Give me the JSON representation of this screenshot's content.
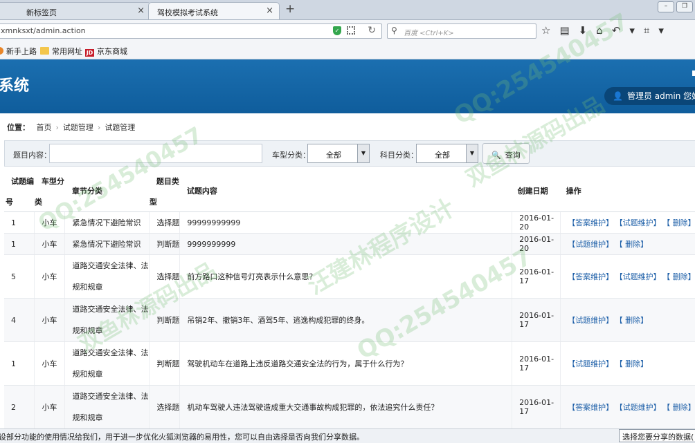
{
  "browser": {
    "tabs": [
      {
        "label": "新标签页",
        "active": false
      },
      {
        "label": "驾校模拟考试系统",
        "active": true
      }
    ],
    "new_tab": "+",
    "url": "xmnksxt/admin.action",
    "search_placeholder": "百度 <Ctrl+K>",
    "bookmarks": [
      {
        "label": "新手上路",
        "icon": "firefox-icon"
      },
      {
        "label": "常用网址",
        "icon": "folder-icon"
      },
      {
        "label": "京东商城",
        "icon": "jd-icon"
      }
    ]
  },
  "header": {
    "title": "系统",
    "user": "管理员 admin 您好"
  },
  "breadcrumb": {
    "label": "位置：",
    "items": [
      "首页",
      "试题管理",
      "试题管理"
    ]
  },
  "filters": {
    "content_label": "题目内容：",
    "car_label": "车型分类：",
    "car_value": "全部",
    "subject_label": "科目分类：",
    "subject_value": "全部",
    "query_button": "查询"
  },
  "table": {
    "headers": {
      "id_top": "试题编",
      "id_bottom": "号",
      "car_top": "车型分",
      "car_bottom": "类",
      "chapter": "章节分类",
      "type_top": "题目类",
      "type_bottom": "型",
      "content": "试题内容",
      "date": "创建日期",
      "ops": "操作"
    },
    "rows": [
      {
        "id": "1",
        "car": "小车",
        "chapter": "紧急情况下避险常识",
        "type": "选择题",
        "content": "99999999999",
        "date": "2016-01-20",
        "ops": [
          "【答案维护】",
          "【试题维护】",
          "【 删除】"
        ]
      },
      {
        "id": "1",
        "car": "小车",
        "chapter": "紧急情况下避险常识",
        "type": "判断题",
        "content": "9999999999",
        "date": "2016-01-20",
        "ops": [
          "【试题维护】",
          "【 删除】"
        ]
      },
      {
        "id": "5",
        "car": "小车",
        "chapter": "道路交通安全法律、法规和规章",
        "type": "选择题",
        "content": "前方路口这种信号灯亮表示什么意思？",
        "date": "2016-01-17",
        "ops": [
          "【答案维护】",
          "【试题维护】",
          "【 删除】"
        ]
      },
      {
        "id": "4",
        "car": "小车",
        "chapter": "道路交通安全法律、法规和规章",
        "type": "判断题",
        "content": "吊销2年、撤销3年、酒驾5年、逃逸构成犯罪的终身。",
        "date": "2016-01-17",
        "ops": [
          "【试题维护】",
          "【 删除】"
        ]
      },
      {
        "id": "1",
        "car": "小车",
        "chapter": "道路交通安全法律、法规和规章",
        "type": "判断题",
        "content": "驾驶机动车在道路上违反道路交通安全法的行为，属于什么行为？",
        "date": "2016-01-17",
        "ops": [
          "【试题维护】",
          "【 删除】"
        ]
      },
      {
        "id": "2",
        "car": "小车",
        "chapter": "道路交通安全法律、法规和规章",
        "type": "选择题",
        "content": "机动车驾驶人违法驾驶造成重大交通事故构成犯罪的，依法追究什么责任？",
        "date": "2016-01-17",
        "ops": [
          "【答案维护】",
          "【试题维护】",
          "【 删除】"
        ]
      }
    ]
  },
  "status_bar": {
    "message": "设部分功能的使用情况给我们，用于进一步优化火狐浏览器的易用性，您可以自由选择是否向我们分享数据。",
    "share_button": "选择您要分享的数据("
  },
  "watermarks": [
    "QQ:254540457",
    "汪建林程序设计",
    "双鱼林源码出品"
  ]
}
